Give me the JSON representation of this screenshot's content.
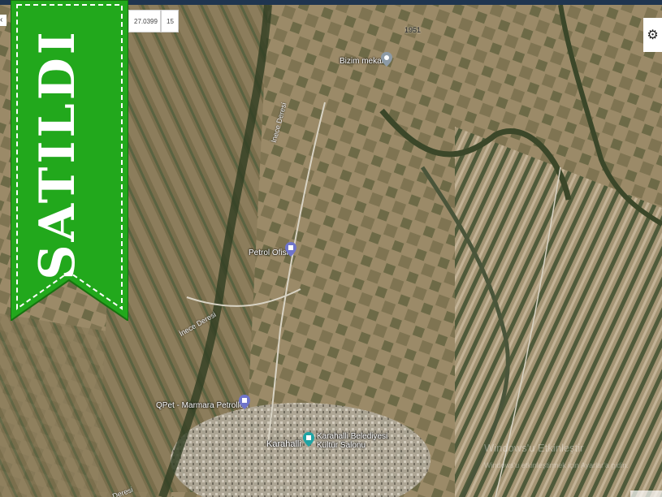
{
  "toolbar": {
    "coordinate": "27.0399",
    "zoom": "15"
  },
  "banner": {
    "text": "SATILDI",
    "color": "#22a81c"
  },
  "map": {
    "places": [
      {
        "name": "Bizim mekan"
      },
      {
        "name": "Petrol Ofisi"
      },
      {
        "name": "QPet - Marmara Petrolleri"
      },
      {
        "name": "Karahalli Belediyesi Kültür Salonu"
      },
      {
        "name": "Karahalli"
      }
    ],
    "roads": {
      "r1951": "1951",
      "inece_deresi_1": "İnece Deresi",
      "inece_deresi_2": "İnece Deresi",
      "deresi": "Deresi"
    },
    "icons": [
      "gear-icon",
      "place-pin-icon",
      "fuel-pin-icon",
      "building-pin-icon"
    ]
  },
  "watermark": {
    "line1": "Windows'u Etkinleştir",
    "line2": "Windows'u etkinleştirmek için Ayarlar'a gidin."
  }
}
